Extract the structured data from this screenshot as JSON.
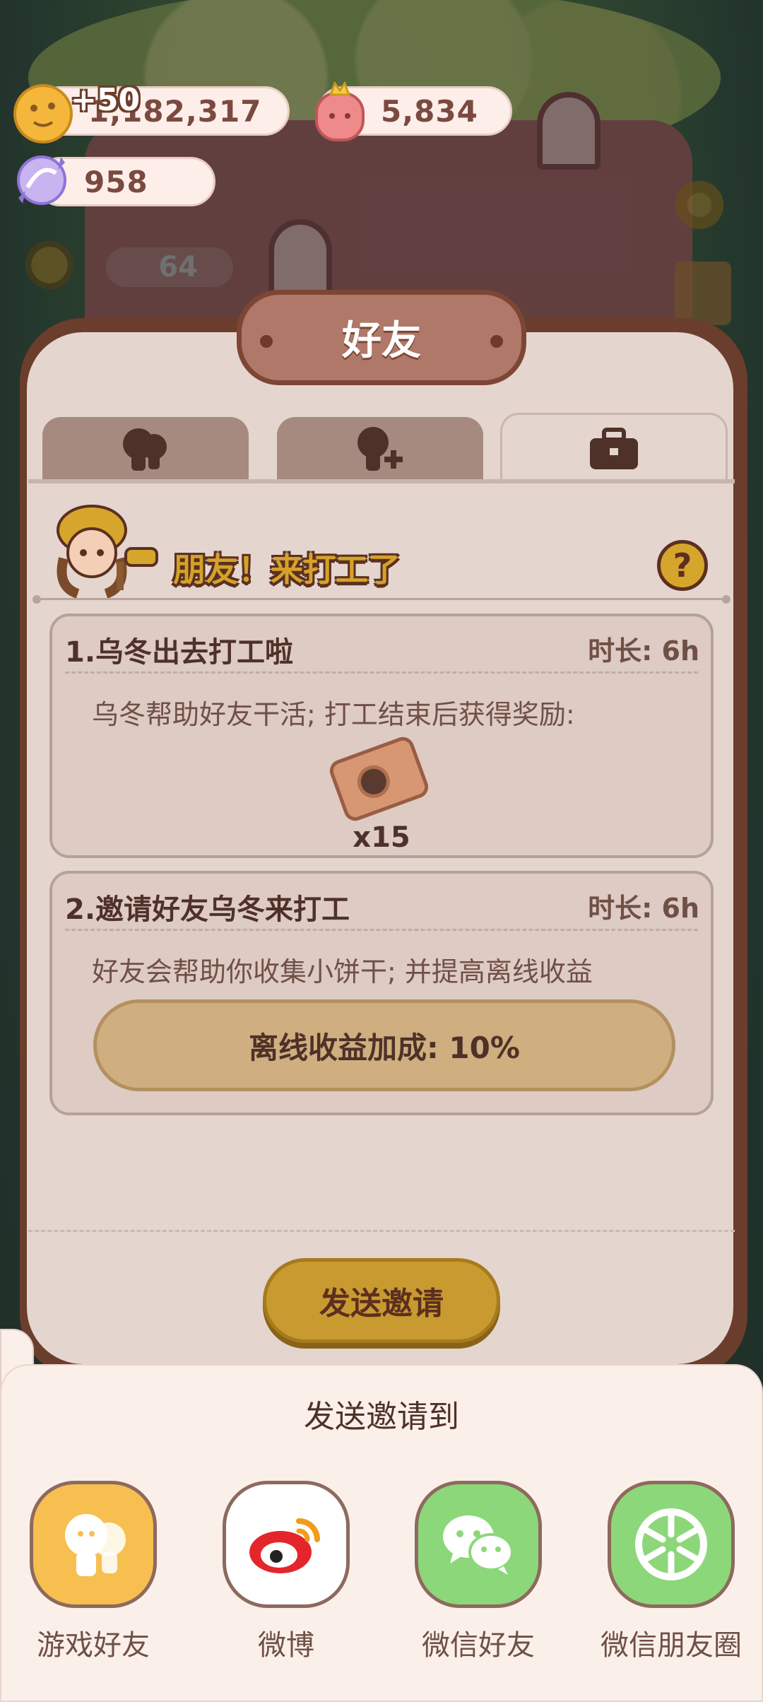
{
  "resources": {
    "cookies": {
      "value": "1,182,317",
      "gain": "+50",
      "icon": "cookie-icon"
    },
    "gems": {
      "value": "5,834",
      "icon": "crown-gem-icon"
    },
    "candy": {
      "value": "958",
      "icon": "candy-icon"
    }
  },
  "background": {
    "counter_value": "64"
  },
  "dialog": {
    "title": "好友",
    "tabs": [
      {
        "icon": "friends-icon",
        "active": false
      },
      {
        "icon": "add-friend-icon",
        "active": false
      },
      {
        "icon": "briefcase-icon",
        "active": true
      }
    ],
    "section_title": "朋友！来打工了",
    "help_label": "?",
    "cards": [
      {
        "title": "1.乌冬出去打工啦",
        "duration": "时长: 6h",
        "description": "乌冬帮助好友干活; 打工结束后获得奖励:",
        "reward_icon": "ticket-icon",
        "reward_count": "x15"
      },
      {
        "title": "2.邀请好友乌冬来打工",
        "duration": "时长: 6h",
        "description": "好友会帮助你收集小饼干; 并提高离线收益",
        "bonus_label": "离线收益加成: 10%"
      }
    ],
    "send_button": "发送邀请"
  },
  "share_sheet": {
    "title": "发送邀请到",
    "handle": "⟩",
    "targets": [
      {
        "label": "游戏好友",
        "icon": "game-friends-icon",
        "color": "#f7bf4f"
      },
      {
        "label": "微博",
        "icon": "weibo-icon",
        "color": "#ffffff"
      },
      {
        "label": "微信好友",
        "icon": "wechat-icon",
        "color": "#8cd779"
      },
      {
        "label": "微信朋友圈",
        "icon": "moments-icon",
        "color": "#8cd779"
      }
    ]
  }
}
